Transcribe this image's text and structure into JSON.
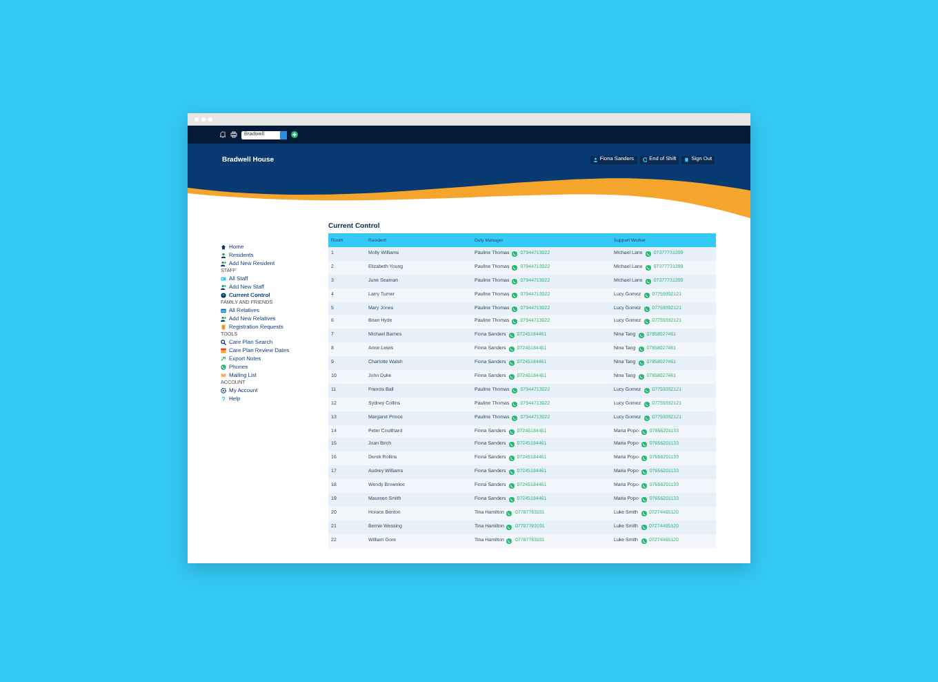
{
  "top_bar": {
    "home_select": {
      "value": "Bradwell"
    }
  },
  "header": {
    "title": "Bradwell House",
    "buttons": [
      {
        "label": "Fiona Sanders",
        "kind": "user"
      },
      {
        "label": "End of Shift",
        "kind": "shift"
      },
      {
        "label": "Sign Out",
        "kind": "signout"
      }
    ]
  },
  "sidebar": [
    {
      "kind": "item",
      "label": "Home",
      "selected": false
    },
    {
      "kind": "item",
      "label": "Residents",
      "selected": false
    },
    {
      "kind": "item",
      "label": "Add New Resident",
      "selected": false
    },
    {
      "kind": "heading",
      "label": "STAFF"
    },
    {
      "kind": "item",
      "label": "All Staff",
      "selected": false
    },
    {
      "kind": "item",
      "label": "Add New Staff",
      "selected": false
    },
    {
      "kind": "item",
      "label": "Current Control",
      "selected": true
    },
    {
      "kind": "heading",
      "label": "FAMILY AND FRIENDS"
    },
    {
      "kind": "item",
      "label": "All Relatives",
      "selected": false
    },
    {
      "kind": "item",
      "label": "Add New Relatives",
      "selected": false
    },
    {
      "kind": "item",
      "label": "Registration Requests",
      "selected": false
    },
    {
      "kind": "heading",
      "label": "TOOLS"
    },
    {
      "kind": "item",
      "label": "Care Plan Search",
      "selected": false
    },
    {
      "kind": "item",
      "label": "Care Plan Review Dates",
      "selected": false
    },
    {
      "kind": "item",
      "label": "Export Notes",
      "selected": false
    },
    {
      "kind": "item",
      "label": "Phones",
      "selected": false
    },
    {
      "kind": "item",
      "label": "Mailing List",
      "selected": false
    },
    {
      "kind": "heading",
      "label": "ACCOUNT"
    },
    {
      "kind": "item",
      "label": "My Account",
      "selected": false
    },
    {
      "kind": "item",
      "label": "Help",
      "selected": false
    }
  ],
  "page_title": "Current Control",
  "table": {
    "columns": [
      "Room",
      "Resident",
      "Duty Manager",
      "Support Worker"
    ],
    "rows": [
      {
        "room": "1",
        "resident": "Molly Williams",
        "manager": "Pauline Thomas",
        "manager_phone": "07944713022",
        "worker": "Michael Lane",
        "worker_phone": "07377731399"
      },
      {
        "room": "2",
        "resident": "Elizabeth Young",
        "manager": "Pauline Thomas",
        "manager_phone": "07944713022",
        "worker": "Michael Lane",
        "worker_phone": "07377731399"
      },
      {
        "room": "3",
        "resident": "June Seaman",
        "manager": "Pauline Thomas",
        "manager_phone": "07944713022",
        "worker": "Michael Lane",
        "worker_phone": "07377731399"
      },
      {
        "room": "4",
        "resident": "Larry Turner",
        "manager": "Pauline Thomas",
        "manager_phone": "07944713022",
        "worker": "Lucy Gomez",
        "worker_phone": "07759392121"
      },
      {
        "room": "5",
        "resident": "Mary Jones",
        "manager": "Pauline Thomas",
        "manager_phone": "07944713022",
        "worker": "Lucy Gomez",
        "worker_phone": "07759392121"
      },
      {
        "room": "6",
        "resident": "Brian Hyde",
        "manager": "Pauline Thomas",
        "manager_phone": "07944713022",
        "worker": "Lucy Gomez",
        "worker_phone": "07759392121"
      },
      {
        "room": "7",
        "resident": "Michael Barnes",
        "manager": "Fiona Sanders",
        "manager_phone": "07245184461",
        "worker": "Nina Tang",
        "worker_phone": "07858027461"
      },
      {
        "room": "8",
        "resident": "Anne Lewis",
        "manager": "Fiona Sanders",
        "manager_phone": "07245184461",
        "worker": "Nina Tang",
        "worker_phone": "07858027461"
      },
      {
        "room": "9",
        "resident": "Charlotte Walsh",
        "manager": "Fiona Sanders",
        "manager_phone": "07245184461",
        "worker": "Nina Tang",
        "worker_phone": "07858027461"
      },
      {
        "room": "10",
        "resident": "John Duke",
        "manager": "Fiona Sanders",
        "manager_phone": "07245184461",
        "worker": "Nina Tang",
        "worker_phone": "07858027461"
      },
      {
        "room": "11",
        "resident": "Francis Ball",
        "manager": "Pauline Thomas",
        "manager_phone": "07944713022",
        "worker": "Lucy Gomez",
        "worker_phone": "07759392121"
      },
      {
        "room": "12",
        "resident": "Sydney Collins",
        "manager": "Pauline Thomas",
        "manager_phone": "07944713022",
        "worker": "Lucy Gomez",
        "worker_phone": "07759392121"
      },
      {
        "room": "13",
        "resident": "Margaret Prince",
        "manager": "Pauline Thomas",
        "manager_phone": "07944713022",
        "worker": "Lucy Gomez",
        "worker_phone": "07759392121"
      },
      {
        "room": "14",
        "resident": "Peter Coulthard",
        "manager": "Fiona Sanders",
        "manager_phone": "07245184461",
        "worker": "Maria Popo",
        "worker_phone": "07656201133"
      },
      {
        "room": "15",
        "resident": "Joan Birch",
        "manager": "Fiona Sanders",
        "manager_phone": "07245184461",
        "worker": "Maria Popo",
        "worker_phone": "07656201133"
      },
      {
        "room": "16",
        "resident": "Derek Rollins",
        "manager": "Fiona Sanders",
        "manager_phone": "07245184461",
        "worker": "Maria Popo",
        "worker_phone": "07656201133"
      },
      {
        "room": "17",
        "resident": "Audrey Williams",
        "manager": "Fiona Sanders",
        "manager_phone": "07245184461",
        "worker": "Maria Popo",
        "worker_phone": "07656201133"
      },
      {
        "room": "18",
        "resident": "Wendy Brownlee",
        "manager": "Fiona Sanders",
        "manager_phone": "07245184461",
        "worker": "Maria Popo",
        "worker_phone": "07656201133"
      },
      {
        "room": "19",
        "resident": "Maureen Smith",
        "manager": "Fiona Sanders",
        "manager_phone": "07245184461",
        "worker": "Maria Popo",
        "worker_phone": "07656201133"
      },
      {
        "room": "20",
        "resident": "Horace Benton",
        "manager": "Tina Hamilton",
        "manager_phone": "07787783191",
        "worker": "Luke Smith",
        "worker_phone": "07274465120"
      },
      {
        "room": "21",
        "resident": "Bernie Wessing",
        "manager": "Tina Hamilton",
        "manager_phone": "07787783191",
        "worker": "Luke Smith",
        "worker_phone": "07274465120"
      },
      {
        "room": "22",
        "resident": "William Gore",
        "manager": "Tina Hamilton",
        "manager_phone": "07787783191",
        "worker": "Luke Smith",
        "worker_phone": "07274465120"
      }
    ]
  }
}
